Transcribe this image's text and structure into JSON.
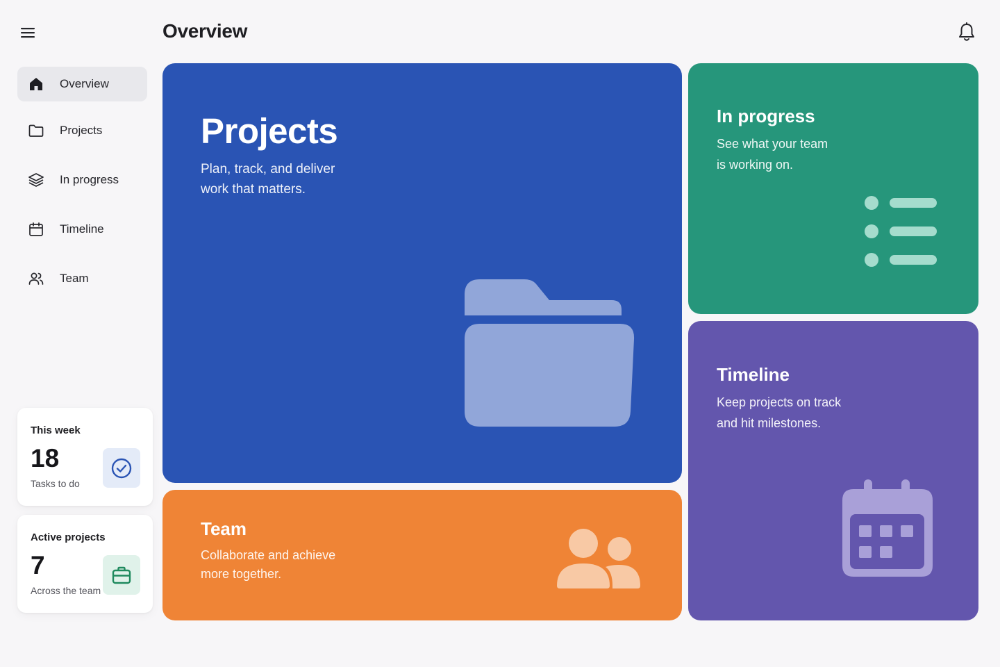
{
  "header": {
    "title": "Overview",
    "menu_icon": "hamburger-menu-icon",
    "notification_icon": "bell-icon"
  },
  "sidebar": {
    "items": [
      {
        "label": "Overview",
        "icon": "home-icon",
        "active": true
      },
      {
        "label": "Projects",
        "icon": "folder-icon",
        "active": false
      },
      {
        "label": "In progress",
        "icon": "layers-icon",
        "active": false
      },
      {
        "label": "Timeline",
        "icon": "calendar-icon",
        "active": false
      },
      {
        "label": "Team",
        "icon": "users-icon",
        "active": false
      }
    ]
  },
  "stats": [
    {
      "title": "This week",
      "value": "18",
      "subtitle": "Tasks to do",
      "icon": "check-circle-icon",
      "accent": "#2a54b4",
      "badge_bg": "#e4ebf8"
    },
    {
      "title": "Active projects",
      "value": "7",
      "subtitle": "Across the team",
      "icon": "briefcase-icon",
      "accent": "#1f8a5e",
      "badge_bg": "#e0f2ea"
    }
  ],
  "tiles": {
    "projects": {
      "title": "Projects",
      "line1": "Plan, track, and deliver",
      "line2": "work that matters.",
      "color": "#2a54b4",
      "icon": "folder-icon"
    },
    "in_progress": {
      "title": "In progress",
      "line1": "See what your team",
      "line2": "is working on.",
      "color": "#26967b",
      "icon": "list-icon"
    },
    "timeline": {
      "title": "Timeline",
      "line1": "Keep projects on track",
      "line2": "and hit milestones.",
      "color": "#6356ad",
      "icon": "calendar-icon"
    },
    "team": {
      "title": "Team",
      "line1": "Collaborate and achieve",
      "line2": "more together.",
      "color": "#ef8436",
      "icon": "users-icon"
    }
  }
}
